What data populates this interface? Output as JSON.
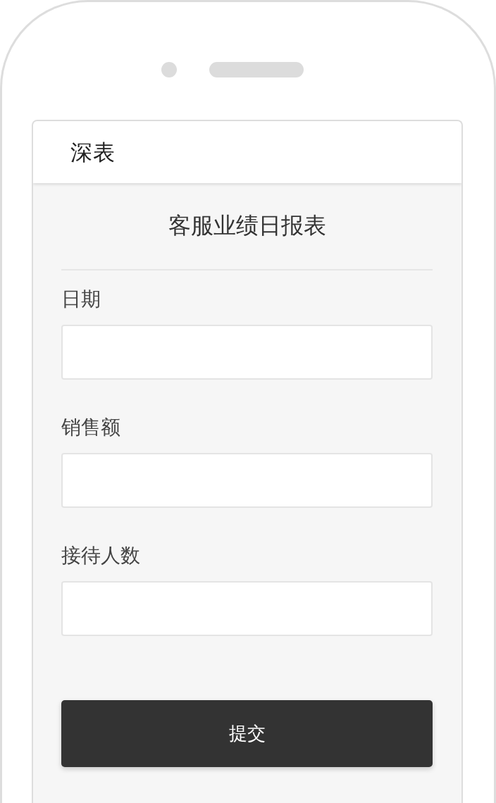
{
  "header": {
    "logo": "深表"
  },
  "form": {
    "title": "客服业绩日报表",
    "fields": [
      {
        "label": "日期"
      },
      {
        "label": "销售额"
      },
      {
        "label": "接待人数"
      }
    ],
    "submit": "提交"
  }
}
